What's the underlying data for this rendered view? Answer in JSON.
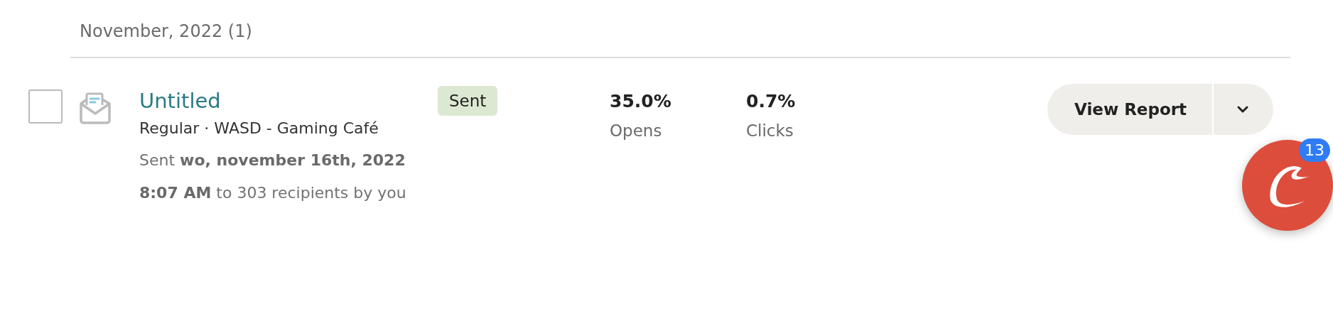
{
  "group_header": "November, 2022 (1)",
  "campaigns": [
    {
      "checked": false,
      "title": "Untitled",
      "subtitle": "Regular · WASD - Gaming Café",
      "sent_info": "Sent **wo, november 16th, 2022 8:07 AM** to 303 recipients by you",
      "status": "Sent",
      "stats": [
        {
          "value": "35.0%",
          "label": "Opens"
        },
        {
          "value": "0.7%",
          "label": "Clicks"
        }
      ],
      "action": "View Report"
    }
  ],
  "chat_bubble": {
    "count": "13"
  }
}
